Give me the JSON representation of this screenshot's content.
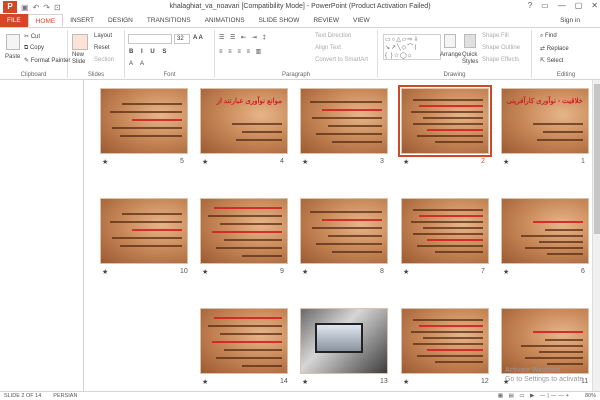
{
  "window": {
    "title": "khalaghiat_va_noavari [Compatibility Mode] - PowerPoint (Product Activation Failed)",
    "app_icon": "P",
    "quick_access": [
      "save-icon",
      "undo-icon",
      "redo-icon",
      "start-icon"
    ],
    "controls": [
      "?",
      "▭",
      "—",
      "▢",
      "✕"
    ]
  },
  "tabs": {
    "file": "FILE",
    "items": [
      "HOME",
      "INSERT",
      "DESIGN",
      "TRANSITIONS",
      "ANIMATIONS",
      "SLIDE SHOW",
      "REVIEW",
      "VIEW"
    ],
    "active": "HOME",
    "signin": "Sign in"
  },
  "ribbon": {
    "clipboard": {
      "paste": "Paste",
      "cut": "Cut",
      "copy": "Copy",
      "format_painter": "Format Painter",
      "label": "Clipboard"
    },
    "slides": {
      "new_slide": "New Slide",
      "layout": "Layout",
      "reset": "Reset",
      "section": "Section",
      "label": "Slides"
    },
    "font": {
      "size": "32",
      "label": "Font"
    },
    "paragraph": {
      "text_direction": "Text Direction",
      "align_text": "Align Text",
      "smartart": "Convert to SmartArt",
      "label": "Paragraph"
    },
    "drawing": {
      "arrange": "Arrange",
      "quick_styles": "Quick Styles",
      "shape_fill": "Shape Fill",
      "shape_outline": "Shape Outline",
      "shape_effects": "Shape Effects",
      "label": "Drawing"
    },
    "editing": {
      "find": "Find",
      "replace": "Replace",
      "select": "Select",
      "label": "Editing"
    }
  },
  "slides": [
    {
      "n": "1",
      "title": "خلاقیت - نوآوری کارآفرینی"
    },
    {
      "n": "2",
      "selected": true
    },
    {
      "n": "3"
    },
    {
      "n": "4",
      "title": "موانع نوآوری عبارتند از"
    },
    {
      "n": "5"
    },
    {
      "n": "6"
    },
    {
      "n": "7"
    },
    {
      "n": "8"
    },
    {
      "n": "9"
    },
    {
      "n": "10"
    },
    {
      "n": "11"
    },
    {
      "n": "12"
    },
    {
      "n": "13"
    },
    {
      "n": "14"
    }
  ],
  "star_mark": "★",
  "status": {
    "slide": "SLIDE 2 OF 14",
    "language": "PERSIAN",
    "zoom": "80%"
  },
  "watermark": {
    "line1": "Activate Windows",
    "line2": "Go to Settings to activate"
  },
  "colors": {
    "accent": "#d24726",
    "slide_bg": "#c98a5a",
    "title_red": "#d02222"
  }
}
